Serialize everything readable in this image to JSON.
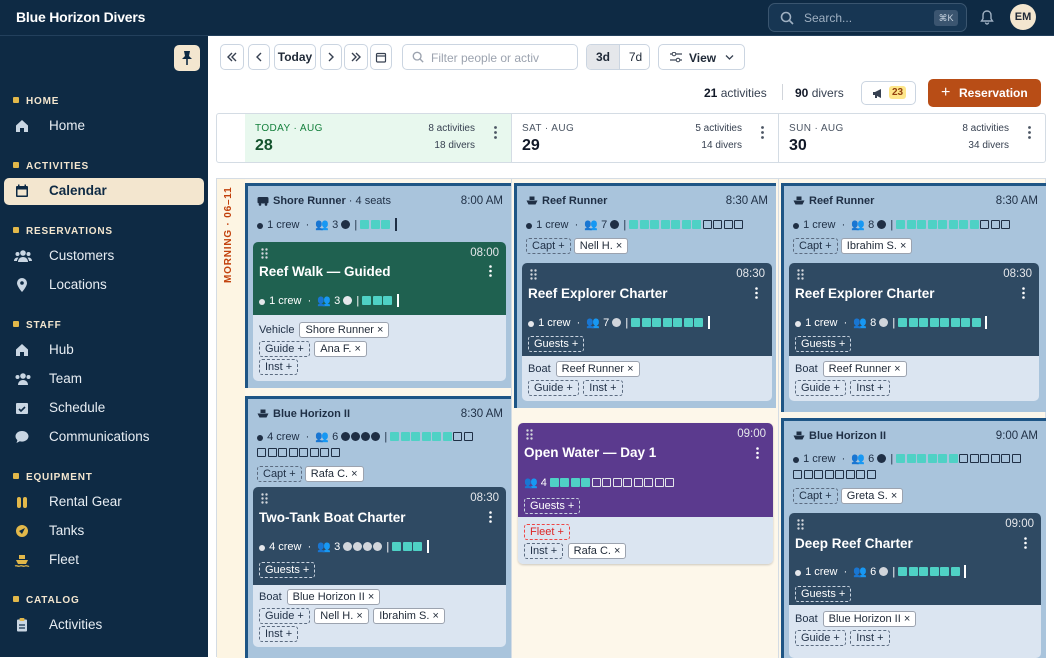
{
  "app": {
    "title": "Blue Horizon Divers"
  },
  "search": {
    "placeholder": "Search...",
    "shortcut": "⌘K"
  },
  "user": {
    "initials": "EM"
  },
  "sidebar": {
    "sections": [
      {
        "title": "HOME",
        "items": [
          {
            "label": "Home",
            "icon": "home-icon"
          }
        ]
      },
      {
        "title": "ACTIVITIES",
        "items": [
          {
            "label": "Calendar",
            "icon": "calendar-icon",
            "active": true
          }
        ]
      },
      {
        "title": "RESERVATIONS",
        "items": [
          {
            "label": "Customers",
            "icon": "users-icon"
          },
          {
            "label": "Locations",
            "icon": "map-pin-icon"
          }
        ]
      },
      {
        "title": "STAFF",
        "items": [
          {
            "label": "Hub",
            "icon": "home-icon"
          },
          {
            "label": "Team",
            "icon": "users-icon"
          },
          {
            "label": "Schedule",
            "icon": "calendar-check-icon"
          },
          {
            "label": "Communications",
            "icon": "chat-icon"
          }
        ]
      },
      {
        "title": "EQUIPMENT",
        "items": [
          {
            "label": "Rental Gear",
            "icon": "gear-bag-icon"
          },
          {
            "label": "Tanks",
            "icon": "tank-icon"
          },
          {
            "label": "Fleet",
            "icon": "boat-icon"
          }
        ]
      },
      {
        "title": "CATALOG",
        "items": [
          {
            "label": "Activities",
            "icon": "clipboard-icon"
          }
        ]
      }
    ]
  },
  "toolbar": {
    "today": "Today",
    "filter_placeholder": "Filter people or activ",
    "range": [
      "3d",
      "7d"
    ],
    "range_selected": "3d",
    "view": "View",
    "activities_count": "21",
    "activities_label": "activities",
    "divers_count": "90",
    "divers_label": "divers",
    "alerts": "23",
    "reservation": "Reservation"
  },
  "days": [
    {
      "label": "TODAY · AUG",
      "num": "28",
      "activities": "8 activities",
      "divers": "18 divers",
      "today": true
    },
    {
      "label": "SAT · AUG",
      "num": "29",
      "activities": "5 activities",
      "divers": "14 divers"
    },
    {
      "label": "SUN · AUG",
      "num": "30",
      "activities": "8 activities",
      "divers": "34 divers"
    }
  ],
  "period": "MORNING · 06–11",
  "col1": {
    "shore": {
      "name": "Shore Runner",
      "seats": "· 4 seats",
      "time": "8:00 AM",
      "crew": "1 crew",
      "count": "3",
      "card": {
        "time": "08:00",
        "title": "Reef Walk — Guided",
        "crew": "1 crew",
        "count": "3",
        "vehicle_label": "Vehicle",
        "vehicle": "Shore Runner",
        "guide_label": "Guide",
        "guide": "Ana F.",
        "inst_label": "Inst"
      }
    },
    "boat": {
      "name": "Blue Horizon II",
      "time": "8:30 AM",
      "crew": "4 crew",
      "count": "6",
      "capt_label": "Capt",
      "capt": "Rafa C.",
      "card": {
        "time": "08:30",
        "title": "Two-Tank Boat Charter",
        "crew": "4 crew",
        "count": "3",
        "guests_label": "Guests",
        "boat_label": "Boat",
        "boat": "Blue Horizon II",
        "guide_label": "Guide",
        "guide1": "Nell H.",
        "guide2": "Ibrahim S.",
        "inst_label": "Inst"
      }
    }
  },
  "col2": {
    "boat": {
      "name": "Reef Runner",
      "time": "8:30 AM",
      "crew": "1 crew",
      "count": "7",
      "capt_label": "Capt",
      "capt": "Nell H.",
      "card": {
        "time": "08:30",
        "title": "Reef Explorer Charter",
        "crew": "1 crew",
        "count": "7",
        "guests_label": "Guests",
        "boat_label": "Boat",
        "boat": "Reef Runner",
        "guide_label": "Guide",
        "inst_label": "Inst"
      }
    },
    "ow": {
      "time": "09:00",
      "title": "Open Water — Day 1",
      "count": "4",
      "guests_label": "Guests",
      "fleet_label": "Fleet",
      "inst_label": "Inst",
      "inst": "Rafa C."
    }
  },
  "col3": {
    "boat1": {
      "name": "Reef Runner",
      "time": "8:30 AM",
      "crew": "1 crew",
      "count": "8",
      "capt_label": "Capt",
      "capt": "Ibrahim S.",
      "card": {
        "time": "08:30",
        "title": "Reef Explorer Charter",
        "crew": "1 crew",
        "count": "8",
        "guests_label": "Guests",
        "boat_label": "Boat",
        "boat": "Reef Runner",
        "guide_label": "Guide",
        "inst_label": "Inst"
      }
    },
    "boat2": {
      "name": "Blue Horizon II",
      "time": "9:00 AM",
      "crew": "1 crew",
      "count": "6",
      "capt_label": "Capt",
      "capt": "Greta S.",
      "card": {
        "time": "09:00",
        "title": "Deep Reef Charter",
        "crew": "1 crew",
        "count": "6",
        "guests_label": "Guests",
        "boat_label": "Boat",
        "boat": "Blue Horizon II",
        "guide_label": "Guide",
        "inst_label": "Inst"
      }
    }
  },
  "colors": {
    "navy": "#0e2a44",
    "cream": "#f3e6cf",
    "accent": "#b84d16",
    "teal": "#4fd1c5",
    "green_card": "#1f6150",
    "slate_card": "#2f4a63",
    "purple_card": "#5b3a8e"
  }
}
